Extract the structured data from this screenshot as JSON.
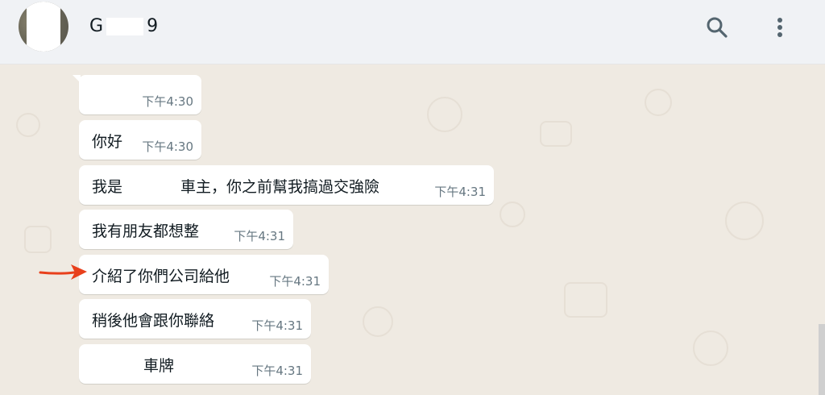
{
  "header": {
    "contact_name_start": "G",
    "contact_name_end": "9",
    "search_icon": "search-icon",
    "menu_icon": "more-vertical-icon"
  },
  "messages": [
    {
      "text": "",
      "time": "下午4:30"
    },
    {
      "text": "你好",
      "time": "下午4:30"
    },
    {
      "text_before": "我是",
      "text_after": "車主，你之前幫我搞過交強險",
      "time": "下午4:31"
    },
    {
      "text": "我有朋友都想整",
      "time": "下午4:31"
    },
    {
      "text": "介紹了你們公司給他",
      "time": "下午4:31"
    },
    {
      "text": "稍後他會跟你聯絡",
      "time": "下午4:31"
    },
    {
      "text_after": "車牌",
      "time": "下午4:31"
    }
  ],
  "annotation": {
    "arrow_color": "#e8401c"
  },
  "colors": {
    "header_bg": "#f0f2f5",
    "chat_bg": "#efeae2",
    "bubble_bg": "#ffffff",
    "text": "#111b21",
    "time": "#667781"
  }
}
